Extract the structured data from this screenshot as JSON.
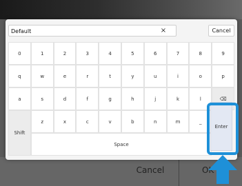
{
  "dialog": {
    "input_value": "Default",
    "clear_label": "×",
    "cancel_label": "Cancel"
  },
  "keyboard": {
    "rows": [
      [
        "0",
        "1",
        "2",
        "3",
        "4",
        "5",
        "6",
        "7",
        "8",
        "9"
      ],
      [
        "q",
        "w",
        "e",
        "r",
        "t",
        "y",
        "u",
        "i",
        "o",
        "p"
      ],
      [
        "a",
        "s",
        "d",
        "f",
        "g",
        "h",
        "j",
        "k",
        "l",
        "⌫"
      ],
      [
        "",
        "z",
        "x",
        "c",
        "v",
        "b",
        "n",
        "m",
        "_"
      ]
    ],
    "shift_label": "Shift",
    "space_label": "Space",
    "enter_label": "Enter"
  },
  "background": {
    "cancel_label": "Cancel",
    "ok_label": "OK"
  },
  "highlight_color": "#1e90d8"
}
